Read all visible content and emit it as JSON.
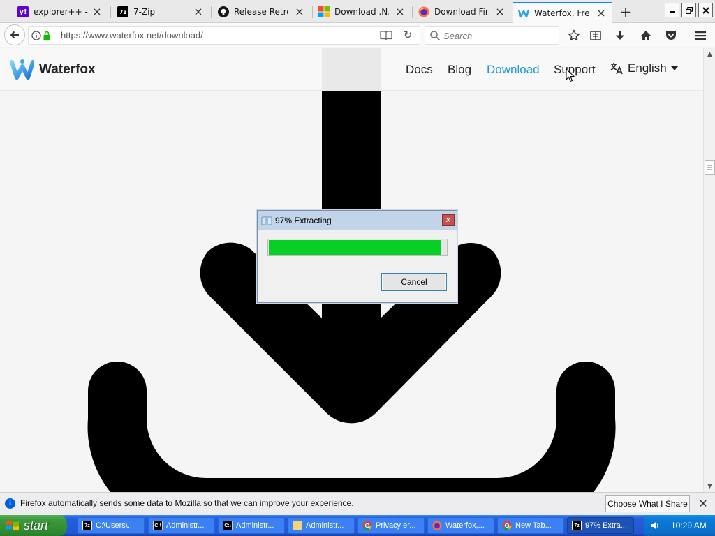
{
  "browser": {
    "tabs": [
      {
        "label": "explorer++ - ...",
        "icon": "yahoo-icon",
        "color": "#6001d2"
      },
      {
        "label": "7-Zip",
        "icon": "7zip-icon",
        "color": "#000000"
      },
      {
        "label": "Release Retro...",
        "icon": "github-icon",
        "color": "#181717"
      },
      {
        "label": "Download .N...",
        "icon": "microsoft-icon",
        "color": "#f25022"
      },
      {
        "label": "Download Fir...",
        "icon": "firefox-icon",
        "color": "#ff7139"
      },
      {
        "label": "Waterfox, Fre...",
        "icon": "waterfox-icon",
        "color": "#2ea3e8",
        "active": true
      }
    ],
    "url": "https://www.waterfox.net/download/",
    "search_placeholder": "Search"
  },
  "site": {
    "brand": "Waterfox",
    "nav": [
      {
        "label": "Docs"
      },
      {
        "label": "Blog"
      },
      {
        "label": "Download",
        "active": true
      },
      {
        "label": "Support"
      }
    ],
    "language": "English",
    "accent_color": "#1a9ad6"
  },
  "dialog": {
    "title": "97% Extracting",
    "progress_percent": 97,
    "cancel_label": "Cancel",
    "progress_color": "#06d025"
  },
  "notification": {
    "text": "Firefox automatically sends some data to Mozilla so that we can improve your experience.",
    "button_label": "Choose What I Share"
  },
  "taskbar": {
    "start_label": "start",
    "tasks": [
      {
        "label": "C:\\Users\\...",
        "icon": "7zip-icon"
      },
      {
        "label": "Administr...",
        "icon": "cmd-icon"
      },
      {
        "label": "Administr...",
        "icon": "cmd-icon"
      },
      {
        "label": "Administr...",
        "icon": "folder-icon"
      },
      {
        "label": "Privacy er...",
        "icon": "chrome-icon"
      },
      {
        "label": "Waterfox,...",
        "icon": "firefox-icon"
      },
      {
        "label": "New Tab...",
        "icon": "chrome-icon"
      },
      {
        "label": "97% Extra...",
        "icon": "7zip-icon",
        "active": true
      }
    ],
    "clock": "10:29 AM"
  }
}
